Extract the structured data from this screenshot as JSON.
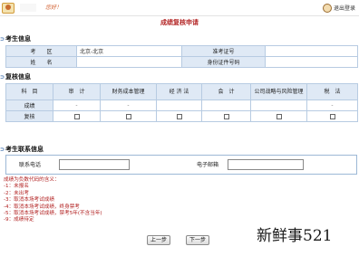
{
  "topbar": {
    "welcome": "您好！",
    "logout": "退出登录"
  },
  "page_title": "成绩复核申请",
  "sections": {
    "candidate": "考生信息",
    "recheck": "复核信息",
    "contact": "考生联系信息"
  },
  "candidate": {
    "region_label": "考　　区",
    "region_value": "北京-北京",
    "admission_label": "准考证号",
    "admission_value": "",
    "name_label": "姓　　名",
    "name_value": "",
    "id_label": "身份证件号码",
    "id_value": ""
  },
  "recheck": {
    "headers": [
      "科　目",
      "审　计",
      "财务成本管理",
      "经 济 法",
      "会　计",
      "公司战略与风险管理",
      "税　法"
    ],
    "score_row_label": "成绩",
    "scores": [
      "-",
      "-",
      "",
      "",
      "",
      "-"
    ],
    "recheck_row_label": "复核"
  },
  "contact": {
    "phone_label": "联系电话",
    "phone_value": "",
    "email_label": "电子邮箱",
    "email_value": ""
  },
  "notes": {
    "heading": "成绩为负数代码的含义：",
    "lines": [
      "-1：未报名",
      "-2：未出考",
      "-3：取消本场考试成绩",
      "-4：取消本场考试成绩，终身禁考",
      "-5：取消本场考试成绩，禁考5年(不含当年)",
      "-9：成绩待定"
    ]
  },
  "buttons": {
    "prev": "上一步",
    "next": "下一步"
  },
  "watermark": "新鲜事521",
  "colors": {
    "header_bg": "#dfe9f5",
    "border": "#b7cbe2",
    "title_red": "#b22222"
  }
}
